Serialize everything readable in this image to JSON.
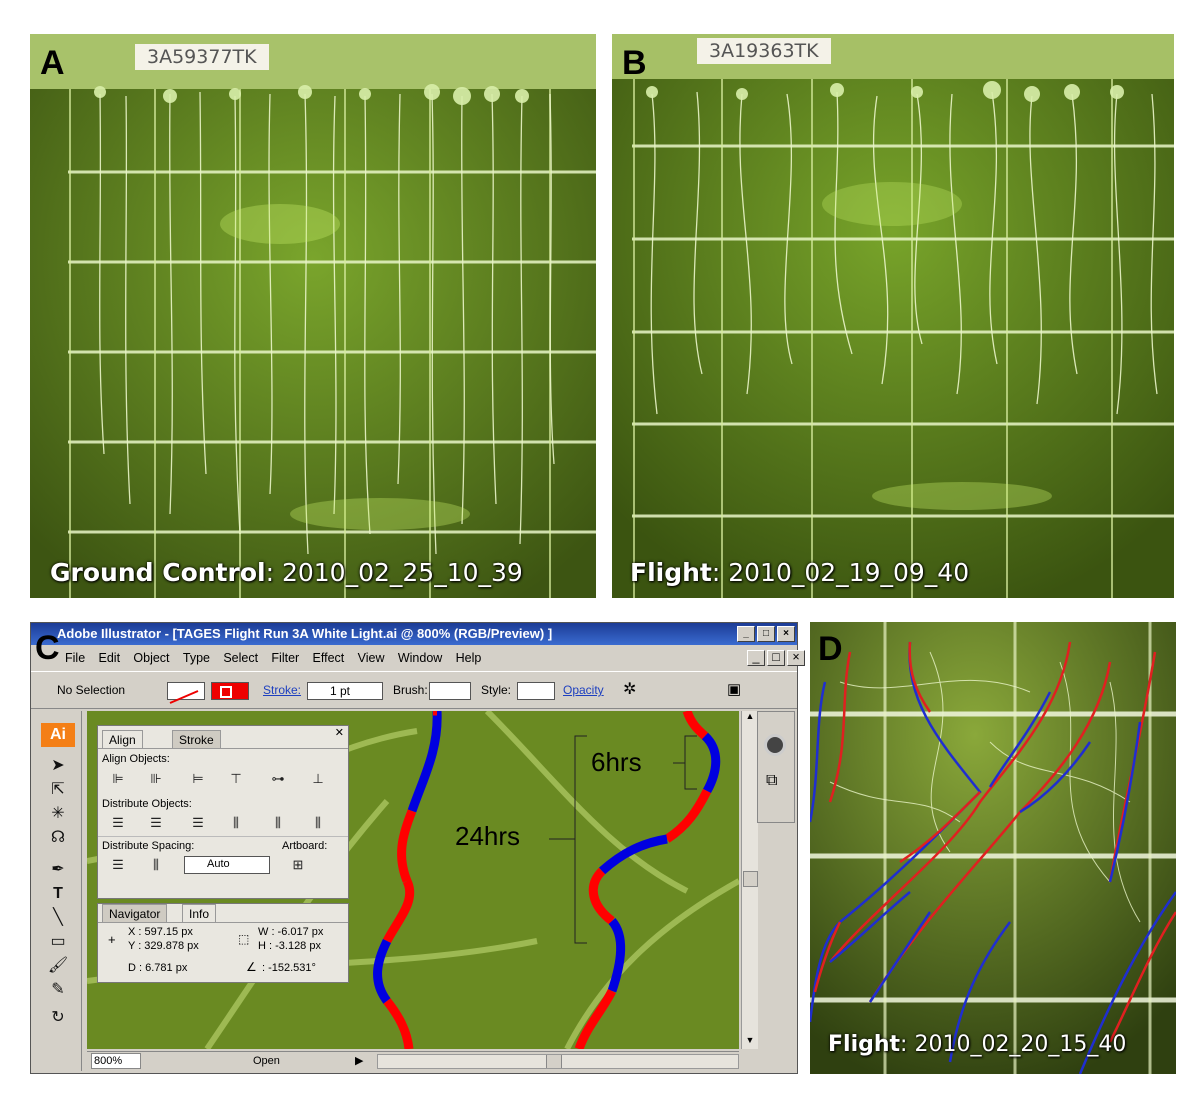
{
  "panels": {
    "A": {
      "label": "A",
      "tag": "3A59377TK",
      "caption_bold": "Ground Control",
      "caption_rest": ":   2010_02_25_10_39"
    },
    "B": {
      "label": "B",
      "tag": "3A19363TK",
      "caption_bold": "Flight",
      "caption_rest": ":   2010_02_19_09_40"
    },
    "C": {
      "label": "C"
    },
    "D": {
      "label": "D",
      "caption_bold": "Flight",
      "caption_rest": ": 2010_02_20_15_40"
    }
  },
  "illustrator": {
    "title": "Adobe Illustrator - [TAGES Flight Run 3A White Light.ai @ 800% (RGB/Preview) ]",
    "window_buttons": [
      "_",
      "□",
      "×"
    ],
    "menu": [
      "File",
      "Edit",
      "Object",
      "Type",
      "Select",
      "Filter",
      "Effect",
      "View",
      "Window",
      "Help"
    ],
    "control": {
      "selection": "No Selection",
      "stroke_label": "Stroke:",
      "stroke_value": "1 pt",
      "brush_label": "Brush:",
      "style_label": "Style:",
      "opacity_label": "Opacity"
    },
    "align_panel": {
      "tabs": [
        "Align",
        "Stroke"
      ],
      "align_objects": "Align Objects:",
      "distribute_objects": "Distribute Objects:",
      "distribute_spacing": "Distribute Spacing:",
      "artboard": "Artboard:",
      "spacing_value": "Auto"
    },
    "info_panel": {
      "tabs": [
        "Navigator",
        "Info"
      ],
      "x": "X  : 597.15 px",
      "y": "Y  : 329.878 px",
      "w": "W  : -6.017 px",
      "h": "H  : -3.128 px",
      "d": "D  : 6.781 px",
      "angle": ": -152.531°"
    },
    "status": {
      "zoom": "800%",
      "mode": "Open"
    },
    "annotations": {
      "short": "6hrs",
      "long": "24hrs"
    },
    "ai_logo": "Ai"
  },
  "colors": {
    "segment_red": "#ff0000",
    "segment_blue": "#0000e0",
    "plate_green": "#6e9a1e"
  }
}
